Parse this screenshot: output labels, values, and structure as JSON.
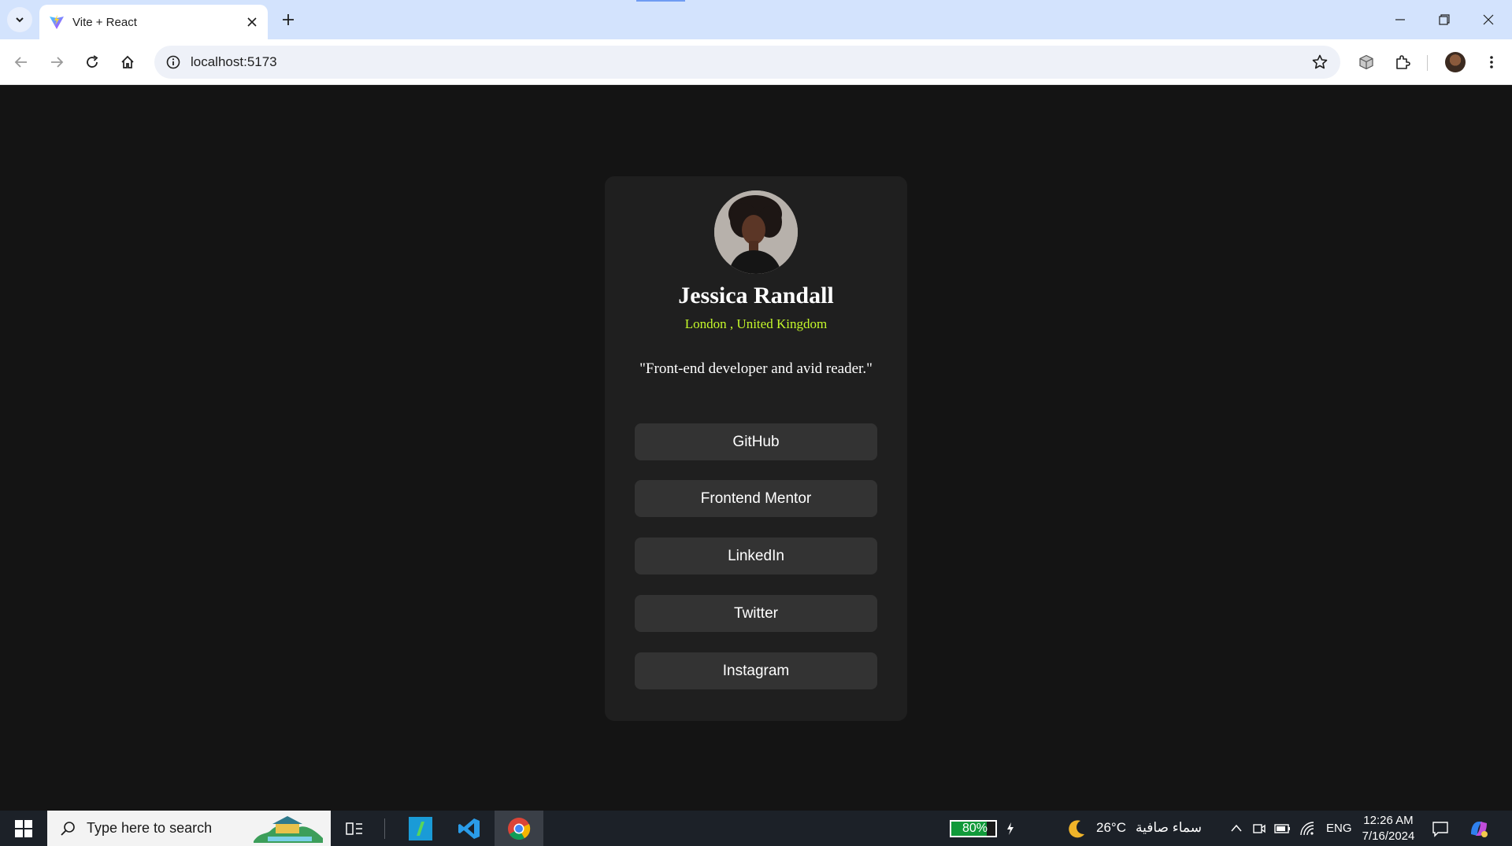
{
  "browser": {
    "tab_title": "Vite + React",
    "url": "localhost:5173"
  },
  "profile": {
    "name": "Jessica Randall",
    "location": "London , United Kingdom",
    "bio": "\"Front-end developer and avid reader.\"",
    "links": [
      {
        "label": "GitHub"
      },
      {
        "label": "Frontend Mentor"
      },
      {
        "label": "LinkedIn"
      },
      {
        "label": "Twitter"
      },
      {
        "label": "Instagram"
      }
    ]
  },
  "taskbar": {
    "search_placeholder": "Type here to search",
    "battery_label": "80%",
    "battery_level": 0.8,
    "weather_temp": "26°C",
    "weather_desc": "سماء صافية",
    "language": "ENG",
    "time": "12:26 AM",
    "date": "7/16/2024"
  },
  "colors": {
    "page_bg": "#141414",
    "card_bg": "#1f1f1f",
    "button_bg": "#333333",
    "accent": "#c4f82a"
  }
}
